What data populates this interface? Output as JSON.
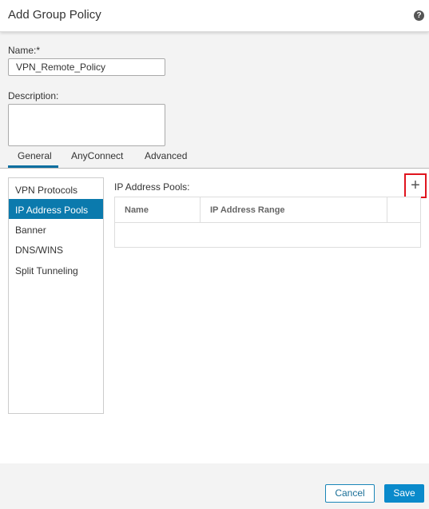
{
  "dialog": {
    "title": "Add Group Policy",
    "help_icon": "question-circle-icon"
  },
  "form": {
    "name_label": "Name:*",
    "name_value": "VPN_Remote_Policy",
    "description_label": "Description:",
    "description_value": ""
  },
  "tabs": [
    {
      "label": "General",
      "active": true
    },
    {
      "label": "AnyConnect"
    },
    {
      "label": "Advanced"
    }
  ],
  "nav": {
    "items": [
      {
        "label": "VPN Protocols"
      },
      {
        "label": "IP Address Pools",
        "selected": true
      },
      {
        "label": "Banner"
      },
      {
        "label": "DNS/WINS"
      },
      {
        "label": "Split Tunneling"
      }
    ]
  },
  "pools": {
    "label": "IP Address Pools:",
    "add_icon": "plus-icon",
    "add_symbol": "+",
    "columns": [
      "Name",
      "IP Address Range"
    ],
    "rows": []
  },
  "footer": {
    "cancel": "Cancel",
    "save": "Save"
  },
  "colors": {
    "accent": "#0b7aad",
    "highlight": "#e0141e"
  }
}
